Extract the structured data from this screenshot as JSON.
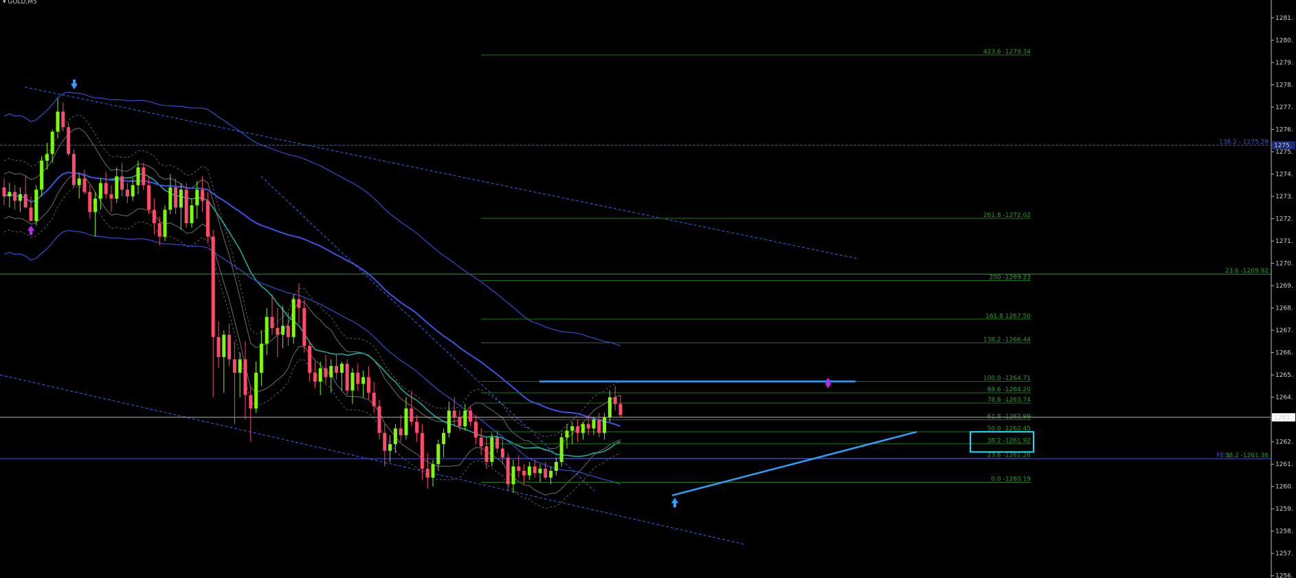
{
  "window": {
    "symbol": "GOLD,M5"
  },
  "colors": {
    "bg": "#000000",
    "axis": "#c0c0c0",
    "bull": "#7cfc00",
    "bear": "#ff4a6a",
    "fib_line": "#1b7a1b",
    "fib_text": "#2aa02a",
    "ma_teal": "#18b5a6",
    "ma_blue": "#3a55e8",
    "band_grey": "#8c8c8c",
    "trend_blue": "#2f6bff",
    "bright_blue": "#2ea0ff",
    "highlight": "#00e5ff",
    "arrow_magenta": "#c026f0"
  },
  "chart_data": {
    "type": "candlestick",
    "symbol": "GOLD,M5",
    "ylim": [
      1255.9,
      1281.8
    ],
    "y_ticks": [
      "1281.",
      "1280.",
      "1279.",
      "1278.",
      "1277.",
      "1276.",
      "1275.",
      "1274.",
      "1273.",
      "1272.",
      "1271.",
      "1270.",
      "1269.",
      "1268.",
      "1267.",
      "1266.",
      "1265.",
      "1264.",
      "1263.",
      "1262.",
      "1261.",
      "1260.",
      "1259.",
      "1258.",
      "1257.",
      "1256."
    ],
    "y_tick_values": [
      1281,
      1280,
      1279,
      1278,
      1277,
      1276,
      1275,
      1274,
      1273,
      1272,
      1271,
      1270,
      1269,
      1268,
      1267,
      1266,
      1265,
      1264,
      1263,
      1262,
      1261,
      1260,
      1259,
      1258,
      1257,
      1256
    ],
    "current_price_label": "1263.",
    "current_price": 1263.1,
    "fib_expansion_levels": [
      {
        "label": "423.6 -1279.34",
        "price": 1279.34
      },
      {
        "label": "261.8 -1272.02",
        "price": 1272.02
      },
      {
        "label": "200 -1269.23",
        "price": 1269.23
      },
      {
        "label": "161.8 1267.50",
        "price": 1267.5
      },
      {
        "label": "138.2 -1266.44",
        "price": 1266.44
      },
      {
        "label": "100.0 -1264.71",
        "price": 1264.71
      },
      {
        "label": "88.6 -1264.20",
        "price": 1264.2
      },
      {
        "label": "78.6 -1263.74",
        "price": 1263.74
      },
      {
        "label": "61.8 -1262.99",
        "price": 1262.99
      },
      {
        "label": "50.0 -1262.45",
        "price": 1262.45
      },
      {
        "label": "38.2 -1261.92",
        "price": 1261.92
      },
      {
        "label": "23.6 -1261.26",
        "price": 1261.26
      },
      {
        "label": "0.0 -1260.19",
        "price": 1260.19
      }
    ],
    "long_levels": [
      {
        "label": "138.2 - 1275.29",
        "price": 1275.29,
        "color": "#3a55e8"
      },
      {
        "label": "23.6 -1269.92",
        "price": 1269.52,
        "color": "#2aa02a"
      },
      {
        "label": "FE 1",
        "price": 1261.25,
        "color": "#3a55e8"
      },
      {
        "label": "38.2 -1261.36",
        "price": 1261.25,
        "color": "#2aa02a"
      }
    ],
    "axis_price_box": "1275.",
    "ohlc": [
      [
        1273.4,
        1273.8,
        1272.6,
        1273.0
      ],
      [
        1273.0,
        1273.6,
        1272.5,
        1273.2
      ],
      [
        1273.2,
        1273.5,
        1272.4,
        1272.8
      ],
      [
        1272.8,
        1273.4,
        1272.3,
        1273.1
      ],
      [
        1273.1,
        1273.9,
        1272.6,
        1272.5
      ],
      [
        1272.5,
        1273.0,
        1271.9,
        1271.9
      ],
      [
        1271.9,
        1273.5,
        1271.7,
        1273.3
      ],
      [
        1273.3,
        1274.8,
        1273.0,
        1274.6
      ],
      [
        1274.6,
        1275.4,
        1274.2,
        1274.9
      ],
      [
        1274.9,
        1276.0,
        1274.5,
        1275.9
      ],
      [
        1275.9,
        1277.4,
        1275.6,
        1276.8
      ],
      [
        1276.8,
        1277.2,
        1275.9,
        1276.1
      ],
      [
        1276.1,
        1276.3,
        1274.8,
        1274.9
      ],
      [
        1274.9,
        1275.1,
        1273.4,
        1273.5
      ],
      [
        1273.5,
        1274.0,
        1272.9,
        1273.8
      ],
      [
        1273.8,
        1274.2,
        1273.1,
        1273.2
      ],
      [
        1273.2,
        1273.5,
        1272.0,
        1272.3
      ],
      [
        1272.3,
        1273.2,
        1271.2,
        1272.9
      ],
      [
        1272.9,
        1273.8,
        1272.4,
        1273.6
      ],
      [
        1273.6,
        1274.1,
        1272.9,
        1273.1
      ],
      [
        1273.1,
        1273.5,
        1272.3,
        1272.9
      ],
      [
        1272.9,
        1274.3,
        1272.7,
        1273.9
      ],
      [
        1273.9,
        1274.5,
        1273.0,
        1273.3
      ],
      [
        1273.3,
        1273.6,
        1272.7,
        1273.0
      ],
      [
        1273.0,
        1273.8,
        1272.8,
        1273.5
      ],
      [
        1273.5,
        1274.6,
        1273.1,
        1274.3
      ],
      [
        1274.3,
        1274.5,
        1273.3,
        1273.5
      ],
      [
        1273.5,
        1273.9,
        1272.2,
        1272.4
      ],
      [
        1272.4,
        1272.9,
        1271.3,
        1271.8
      ],
      [
        1271.8,
        1272.1,
        1270.8,
        1271.2
      ],
      [
        1271.2,
        1272.6,
        1271.0,
        1272.4
      ],
      [
        1272.4,
        1274.0,
        1272.2,
        1273.4
      ],
      [
        1273.4,
        1273.8,
        1272.2,
        1272.5
      ],
      [
        1272.5,
        1273.6,
        1271.5,
        1273.3
      ],
      [
        1273.3,
        1273.6,
        1271.6,
        1271.8
      ],
      [
        1271.8,
        1272.9,
        1271.6,
        1272.6
      ],
      [
        1272.6,
        1273.7,
        1272.0,
        1273.3
      ],
      [
        1273.3,
        1273.9,
        1272.3,
        1272.8
      ],
      [
        1272.8,
        1273.2,
        1270.9,
        1271.2
      ],
      [
        1271.2,
        1271.5,
        1264.0,
        1266.7
      ],
      [
        1266.7,
        1267.4,
        1265.3,
        1265.8
      ],
      [
        1265.8,
        1267.0,
        1264.2,
        1266.8
      ],
      [
        1266.8,
        1267.3,
        1265.4,
        1265.7
      ],
      [
        1265.7,
        1266.5,
        1262.8,
        1265.1
      ],
      [
        1265.1,
        1266.0,
        1264.0,
        1265.7
      ],
      [
        1265.7,
        1266.5,
        1263.0,
        1264.1
      ],
      [
        1264.1,
        1264.5,
        1262.0,
        1263.5
      ],
      [
        1263.5,
        1265.6,
        1263.3,
        1265.1
      ],
      [
        1265.1,
        1267.0,
        1264.5,
        1266.4
      ],
      [
        1266.4,
        1268.0,
        1265.9,
        1267.6
      ],
      [
        1267.6,
        1268.6,
        1266.8,
        1267.1
      ],
      [
        1267.1,
        1268.0,
        1265.8,
        1266.8
      ],
      [
        1266.8,
        1268.1,
        1266.2,
        1267.2
      ],
      [
        1267.2,
        1267.8,
        1266.3,
        1266.7
      ],
      [
        1266.7,
        1268.6,
        1266.4,
        1268.4
      ],
      [
        1268.4,
        1269.1,
        1267.3,
        1268.0
      ],
      [
        1268.0,
        1268.4,
        1266.0,
        1266.3
      ],
      [
        1266.3,
        1266.5,
        1264.7,
        1265.1
      ],
      [
        1265.1,
        1265.6,
        1264.4,
        1264.7
      ],
      [
        1264.7,
        1265.6,
        1264.1,
        1265.3
      ],
      [
        1265.3,
        1265.9,
        1264.6,
        1264.9
      ],
      [
        1264.9,
        1265.7,
        1264.2,
        1265.4
      ],
      [
        1265.4,
        1265.9,
        1264.8,
        1265.1
      ],
      [
        1265.1,
        1265.6,
        1264.3,
        1265.5
      ],
      [
        1265.5,
        1265.7,
        1264.1,
        1264.3
      ],
      [
        1264.3,
        1265.3,
        1263.7,
        1265.1
      ],
      [
        1265.1,
        1265.5,
        1264.3,
        1264.6
      ],
      [
        1264.6,
        1265.2,
        1264.0,
        1264.9
      ],
      [
        1264.9,
        1265.4,
        1263.9,
        1264.2
      ],
      [
        1264.2,
        1264.7,
        1263.3,
        1263.6
      ],
      [
        1263.6,
        1263.9,
        1262.1,
        1262.4
      ],
      [
        1262.4,
        1262.8,
        1260.9,
        1261.6
      ],
      [
        1261.6,
        1262.3,
        1261.1,
        1261.9
      ],
      [
        1261.9,
        1262.8,
        1261.5,
        1262.6
      ],
      [
        1262.6,
        1263.2,
        1262.0,
        1262.3
      ],
      [
        1262.3,
        1264.0,
        1262.1,
        1263.5
      ],
      [
        1263.5,
        1264.3,
        1262.7,
        1262.9
      ],
      [
        1262.9,
        1263.2,
        1262.0,
        1262.4
      ],
      [
        1262.4,
        1262.8,
        1260.3,
        1260.8
      ],
      [
        1260.8,
        1261.5,
        1259.9,
        1260.4
      ],
      [
        1260.4,
        1261.2,
        1260.0,
        1261.0
      ],
      [
        1261.0,
        1262.1,
        1260.7,
        1261.9
      ],
      [
        1261.9,
        1262.6,
        1261.3,
        1262.4
      ],
      [
        1262.4,
        1263.8,
        1262.2,
        1263.4
      ],
      [
        1263.4,
        1264.0,
        1262.7,
        1263.1
      ],
      [
        1263.1,
        1263.4,
        1262.5,
        1262.7
      ],
      [
        1262.7,
        1263.7,
        1262.5,
        1263.4
      ],
      [
        1263.4,
        1263.6,
        1262.7,
        1262.9
      ],
      [
        1262.9,
        1263.2,
        1261.9,
        1262.2
      ],
      [
        1262.2,
        1262.6,
        1261.4,
        1261.8
      ],
      [
        1261.8,
        1262.2,
        1260.8,
        1261.1
      ],
      [
        1261.1,
        1262.4,
        1260.9,
        1262.2
      ],
      [
        1262.2,
        1262.5,
        1261.5,
        1261.7
      ],
      [
        1261.7,
        1262.1,
        1261.0,
        1261.3
      ],
      [
        1261.3,
        1261.5,
        1259.8,
        1260.1
      ],
      [
        1260.1,
        1261.2,
        1259.7,
        1260.9
      ],
      [
        1260.9,
        1261.4,
        1260.4,
        1260.7
      ],
      [
        1260.7,
        1261.0,
        1260.1,
        1260.5
      ],
      [
        1260.5,
        1261.1,
        1260.3,
        1260.9
      ],
      [
        1260.9,
        1261.2,
        1260.4,
        1260.6
      ],
      [
        1260.6,
        1261.0,
        1260.2,
        1260.8
      ],
      [
        1260.8,
        1261.1,
        1260.3,
        1260.4
      ],
      [
        1260.4,
        1260.9,
        1260.1,
        1260.7
      ],
      [
        1260.7,
        1261.3,
        1260.5,
        1261.1
      ],
      [
        1261.1,
        1262.4,
        1260.9,
        1262.2
      ],
      [
        1262.2,
        1262.8,
        1261.7,
        1262.5
      ],
      [
        1262.5,
        1262.9,
        1261.9,
        1262.7
      ],
      [
        1262.7,
        1263.0,
        1262.0,
        1262.4
      ],
      [
        1262.4,
        1262.9,
        1262.1,
        1262.8
      ],
      [
        1262.8,
        1263.2,
        1262.3,
        1262.6
      ],
      [
        1262.6,
        1263.1,
        1262.3,
        1263.0
      ],
      [
        1263.0,
        1263.3,
        1262.2,
        1262.4
      ],
      [
        1262.4,
        1263.3,
        1262.1,
        1263.1
      ],
      [
        1263.1,
        1264.3,
        1262.9,
        1264.0
      ],
      [
        1264.0,
        1264.5,
        1263.4,
        1263.7
      ],
      [
        1263.7,
        1264.1,
        1263.1,
        1263.2
      ]
    ]
  }
}
